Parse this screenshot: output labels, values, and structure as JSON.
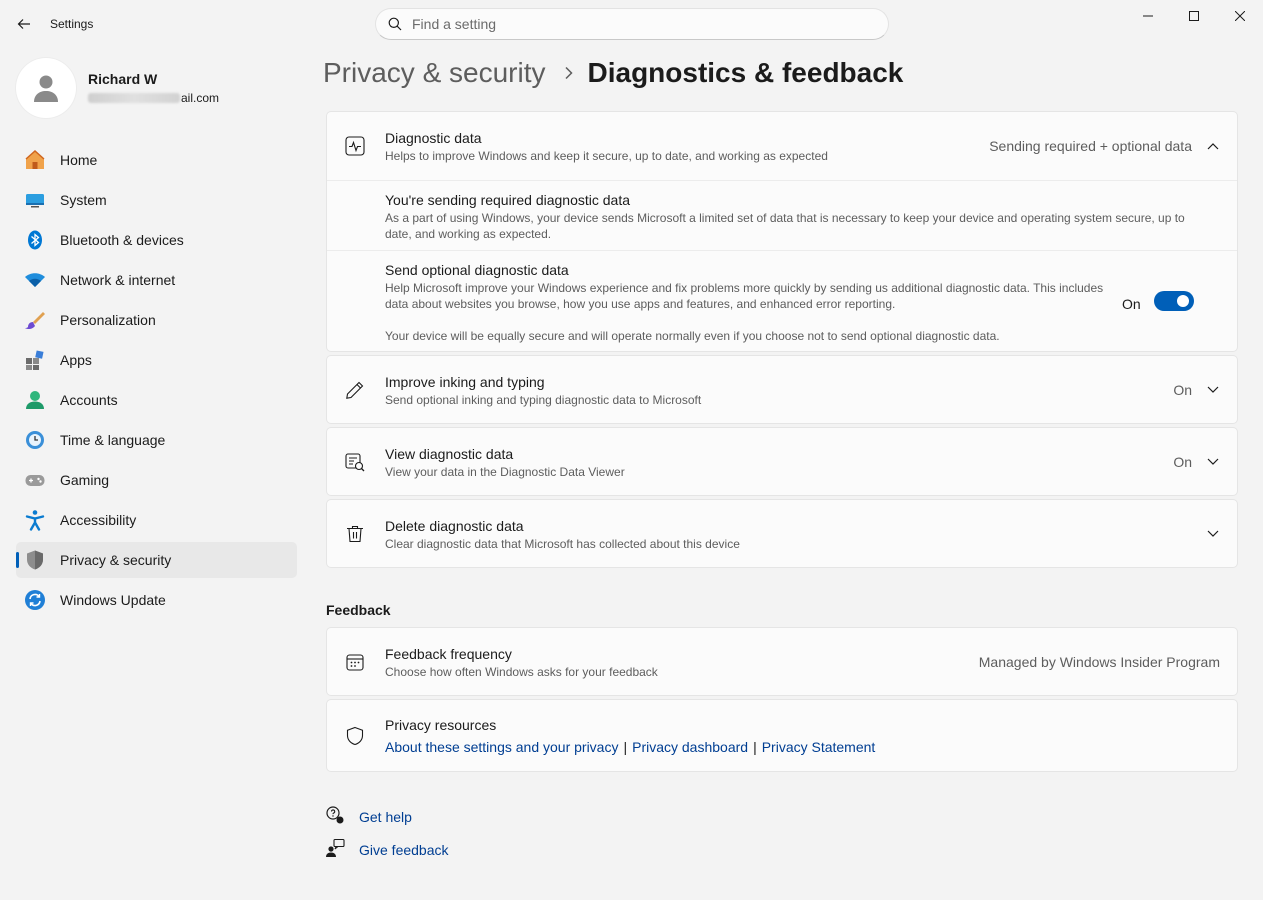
{
  "window": {
    "title": "Settings",
    "search_placeholder": "Find a setting"
  },
  "profile": {
    "name": "Richard W",
    "email_visible": "ail.com"
  },
  "sidebar": {
    "items": [
      {
        "label": "Home",
        "icon": "home-icon"
      },
      {
        "label": "System",
        "icon": "system-icon"
      },
      {
        "label": "Bluetooth & devices",
        "icon": "bluetooth-icon"
      },
      {
        "label": "Network & internet",
        "icon": "wifi-icon"
      },
      {
        "label": "Personalization",
        "icon": "brush-icon"
      },
      {
        "label": "Apps",
        "icon": "apps-icon"
      },
      {
        "label": "Accounts",
        "icon": "accounts-icon"
      },
      {
        "label": "Time & language",
        "icon": "clock-globe-icon"
      },
      {
        "label": "Gaming",
        "icon": "gamepad-icon"
      },
      {
        "label": "Accessibility",
        "icon": "accessibility-icon"
      },
      {
        "label": "Privacy & security",
        "icon": "shield-icon",
        "selected": true
      },
      {
        "label": "Windows Update",
        "icon": "update-icon"
      }
    ]
  },
  "breadcrumb": {
    "parent": "Privacy & security",
    "current": "Diagnostics & feedback"
  },
  "diagnostic_data": {
    "title": "Diagnostic data",
    "desc": "Helps to improve Windows and keep it secure, up to date, and working as expected",
    "status": "Sending required + optional data",
    "expanded": true,
    "required": {
      "title": "You're sending required diagnostic data",
      "desc": "As a part of using Windows, your device sends Microsoft a limited set of data that is necessary to keep your device and operating system secure, up to date, and working as expected."
    },
    "optional": {
      "title": "Send optional diagnostic data",
      "desc": "Help Microsoft improve your Windows experience and fix problems more quickly by sending us additional diagnostic data. This includes data about websites you browse, how you use apps and features, and enhanced error reporting.",
      "note": "Your device will be equally secure and will operate normally even if you choose not to send optional diagnostic data.",
      "toggle_label": "On",
      "toggle_on": true
    }
  },
  "inking": {
    "title": "Improve inking and typing",
    "desc": "Send optional inking and typing diagnostic data to Microsoft",
    "status": "On"
  },
  "view_data": {
    "title": "View diagnostic data",
    "desc": "View your data in the Diagnostic Data Viewer",
    "status": "On"
  },
  "delete_data": {
    "title": "Delete diagnostic data",
    "desc": "Clear diagnostic data that Microsoft has collected about this device"
  },
  "feedback_section": {
    "title": "Feedback"
  },
  "feedback_frequency": {
    "title": "Feedback frequency",
    "desc": "Choose how often Windows asks for your feedback",
    "status": "Managed by Windows Insider Program"
  },
  "privacy_resources": {
    "title": "Privacy resources",
    "links": [
      "About these settings and your privacy",
      "Privacy dashboard",
      "Privacy Statement"
    ],
    "separator": "|"
  },
  "help": {
    "get_help": "Get help",
    "give_feedback": "Give feedback"
  },
  "colors": {
    "accent": "#005fb8",
    "link": "#003e92",
    "background": "#f3f3f3",
    "card": "#fbfbfb"
  }
}
